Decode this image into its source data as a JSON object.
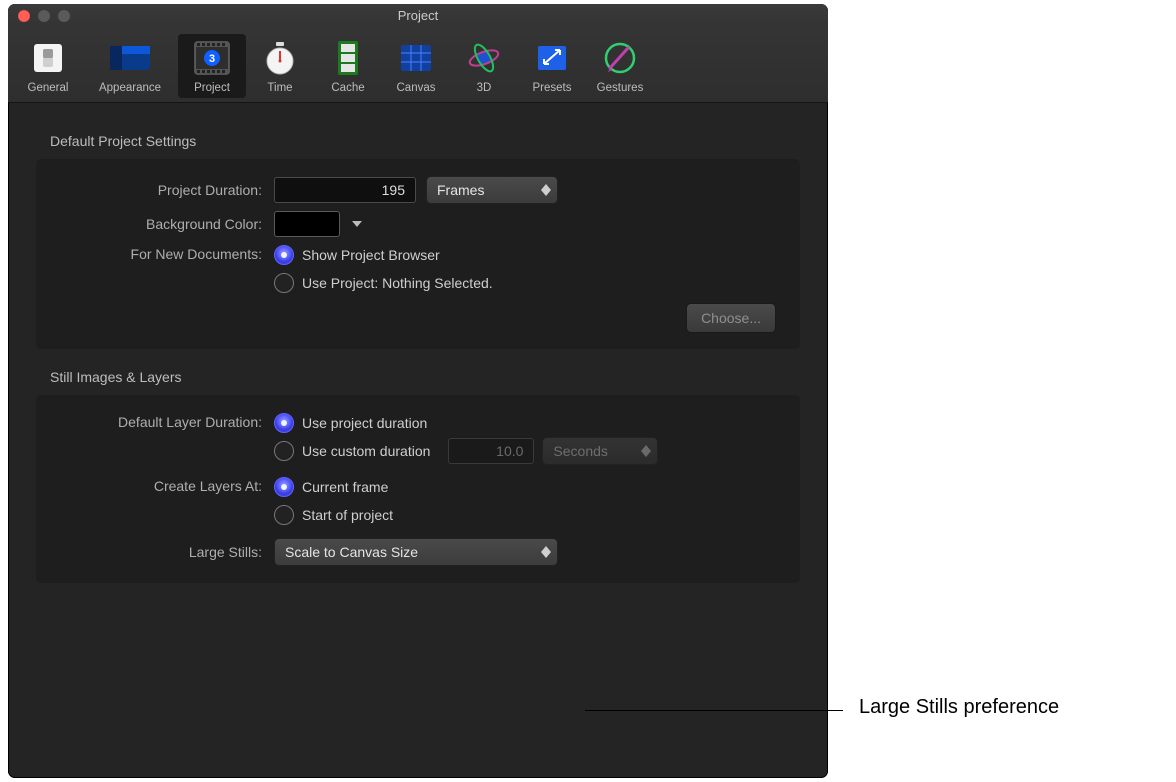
{
  "window": {
    "title": "Project"
  },
  "toolbar": {
    "tabs": [
      {
        "label": "General"
      },
      {
        "label": "Appearance"
      },
      {
        "label": "Project"
      },
      {
        "label": "Time"
      },
      {
        "label": "Cache"
      },
      {
        "label": "Canvas"
      },
      {
        "label": "3D"
      },
      {
        "label": "Presets"
      },
      {
        "label": "Gestures"
      }
    ],
    "selected_index": 2
  },
  "sections": {
    "project": {
      "title": "Default Project Settings",
      "duration_label": "Project Duration:",
      "duration_value": "195",
      "duration_unit": "Frames",
      "bgcolor_label": "Background Color:",
      "bgcolor_value": "#000000",
      "newdoc_label": "For New Documents:",
      "newdoc_opt1": "Show Project Browser",
      "newdoc_opt2": "Use Project: Nothing Selected.",
      "newdoc_selected": 0,
      "choose_btn": "Choose..."
    },
    "stills": {
      "title": "Still Images & Layers",
      "layer_dur_label": "Default Layer Duration:",
      "layer_dur_opt1": "Use project duration",
      "layer_dur_opt2": "Use custom duration",
      "layer_dur_selected": 0,
      "custom_value": "10.0",
      "custom_unit": "Seconds",
      "create_at_label": "Create Layers At:",
      "create_at_opt1": "Current frame",
      "create_at_opt2": "Start of project",
      "create_at_selected": 0,
      "large_stills_label": "Large Stills:",
      "large_stills_value": "Scale to Canvas Size"
    }
  },
  "callout": "Large Stills preference"
}
